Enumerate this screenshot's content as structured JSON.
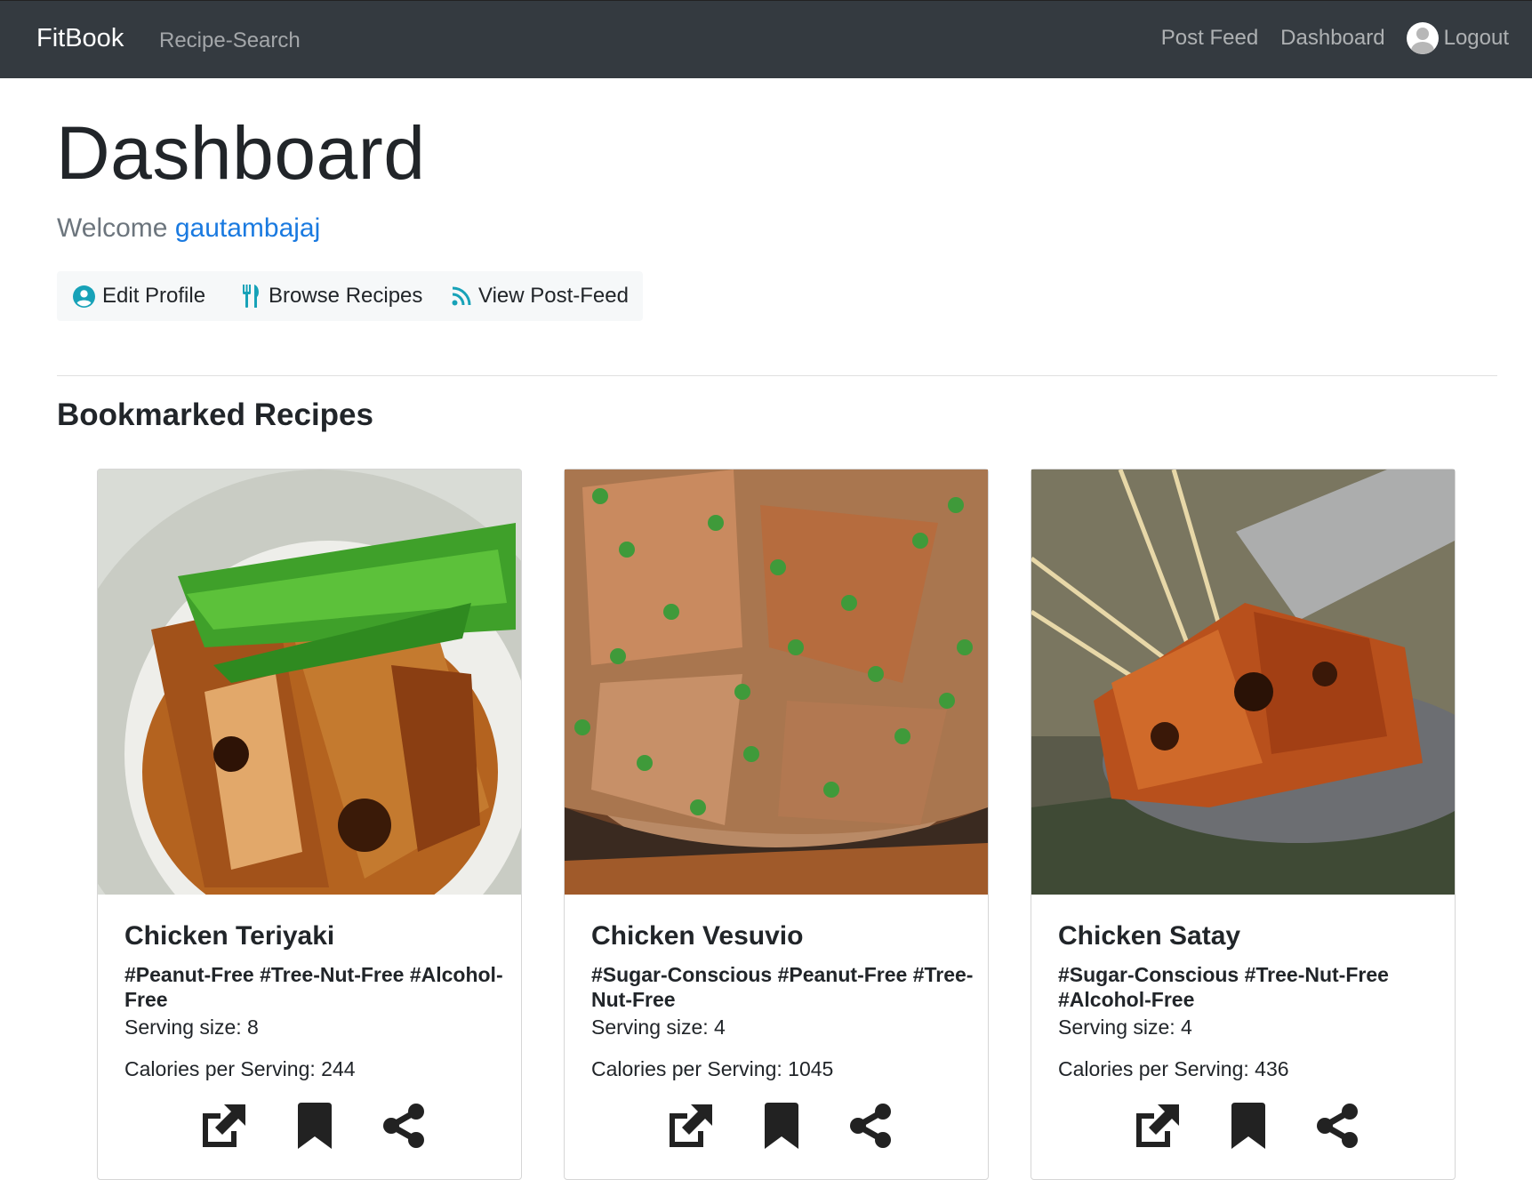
{
  "navbar": {
    "brand": "FitBook",
    "left_link": "Recipe-Search",
    "right_links": [
      "Post Feed",
      "Dashboard"
    ],
    "logout": "Logout"
  },
  "header": {
    "title": "Dashboard",
    "welcome_prefix": "Welcome",
    "username": "gautambajaj"
  },
  "actions": {
    "edit_profile": "Edit Profile",
    "browse_recipes": "Browse Recipes",
    "view_post_feed": "View Post-Feed"
  },
  "section": {
    "title": "Bookmarked Recipes"
  },
  "recipes": [
    {
      "title": "Chicken Teriyaki",
      "tags": "#Peanut-Free #Tree-Nut-Free #Alcohol-Free",
      "serving": "Serving size: 8",
      "calories": "Calories per Serving: 244"
    },
    {
      "title": "Chicken Vesuvio",
      "tags": "#Sugar-Conscious #Peanut-Free #Tree-Nut-Free",
      "serving": "Serving size: 4",
      "calories": "Calories per Serving: 1045"
    },
    {
      "title": "Chicken Satay",
      "tags": "#Sugar-Conscious #Tree-Nut-Free #Alcohol-Free",
      "serving": "Serving size: 4",
      "calories": "Calories per Serving: 436"
    }
  ],
  "colors": {
    "navbar_bg": "#343a40",
    "accent_link": "#1a7ae0",
    "icon_teal": "#17a2b8"
  },
  "icons": [
    "user-circle-icon",
    "utensils-icon",
    "rss-icon",
    "external-link-icon",
    "bookmark-icon",
    "share-icon"
  ]
}
